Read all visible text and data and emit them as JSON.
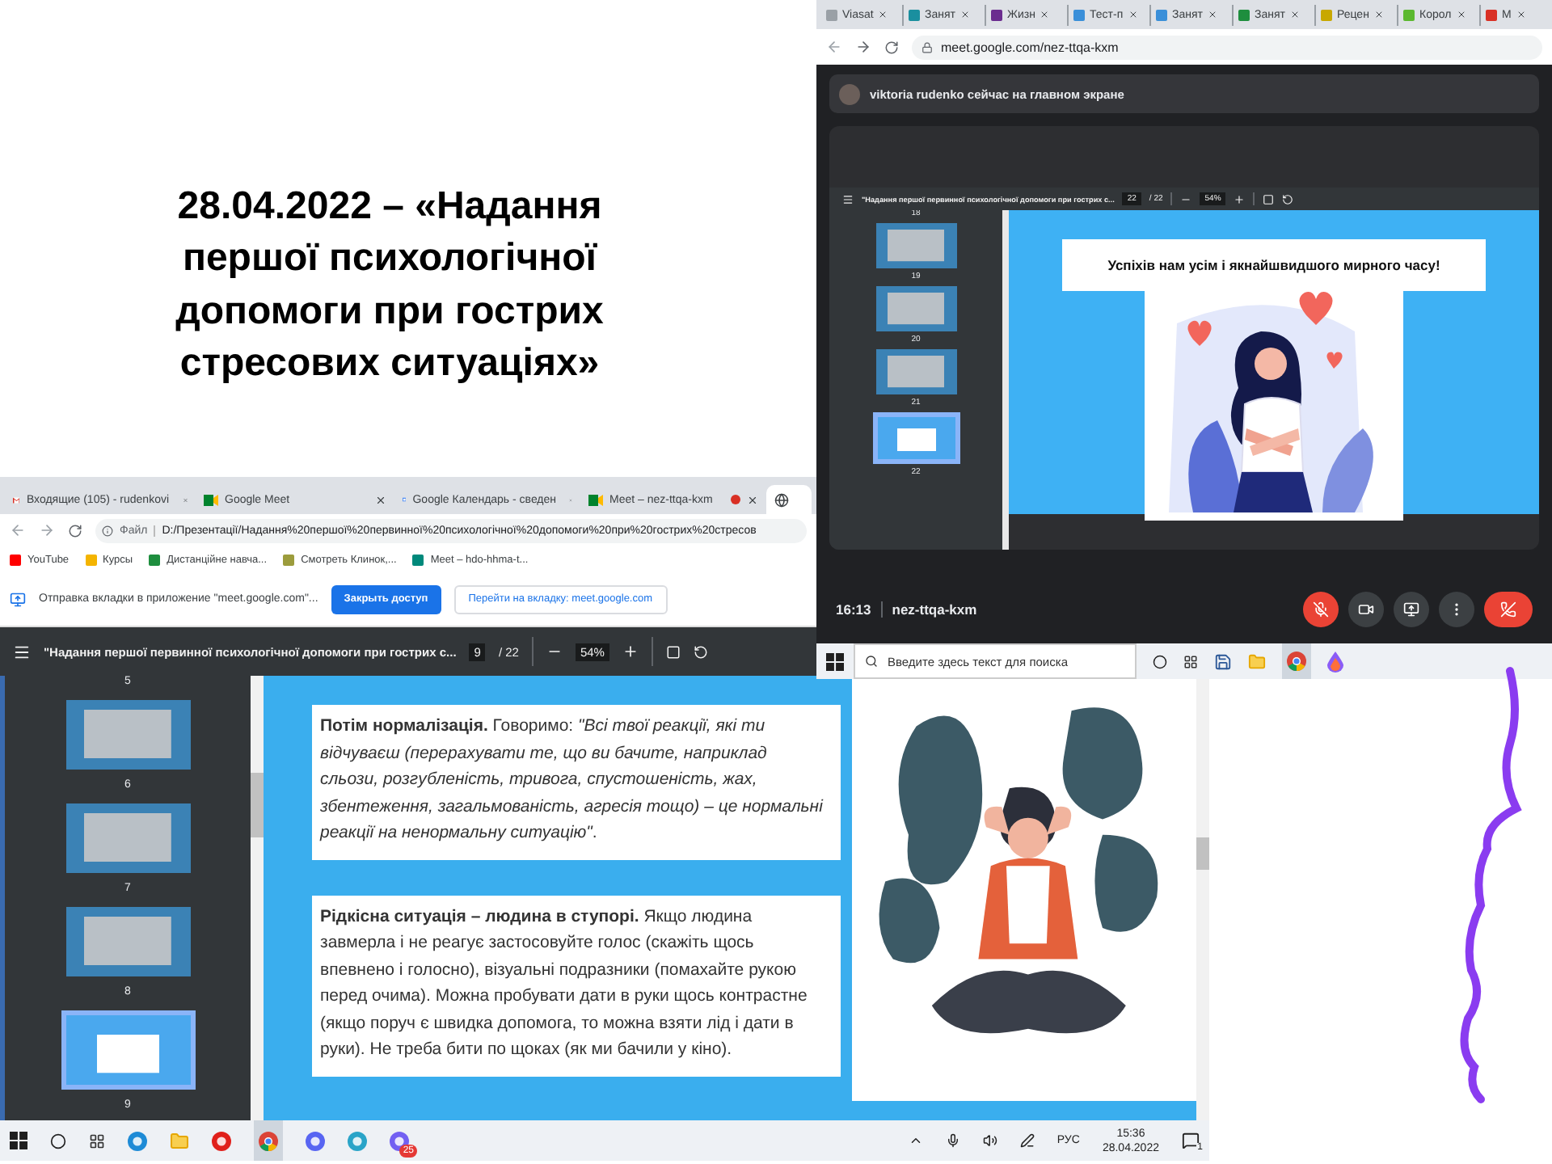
{
  "slide_title": "28.04.2022 – «Надання першої психологічної допомоги при гострих стресових ситуаціях»",
  "meet_window": {
    "tabs": [
      {
        "label": "Viasat",
        "color": "#9aa0a6",
        "selected": false
      },
      {
        "label": "Занят",
        "color": "#1a8f9f",
        "selected": false
      },
      {
        "label": "Жизн",
        "color": "#6b2c8f",
        "selected": false
      },
      {
        "label": "Тест-п",
        "color": "#3a8fd9",
        "selected": false
      },
      {
        "label": "Занят",
        "color": "#3a8fd9",
        "selected": false
      },
      {
        "label": "Занят",
        "color": "#1e8e3e",
        "selected": false
      },
      {
        "label": "Рецен",
        "color": "#c8a800",
        "selected": false
      },
      {
        "label": "Корол",
        "color": "#5bb82f",
        "selected": false
      },
      {
        "label": "M",
        "color": "#d93025",
        "selected": false
      }
    ],
    "url": "meet.google.com/nez-ttqa-kxm",
    "banner": "viktoria rudenko сейчас на главном экране",
    "pdf": {
      "title": "\"Надання першої первинної психологічної допомоги при гострих с...",
      "page": "22",
      "pages": "/ 22",
      "zoom": "54%",
      "top_number": "18",
      "thumbnails": [
        {
          "number": "19",
          "selected": false
        },
        {
          "number": "20",
          "selected": false
        },
        {
          "number": "21",
          "selected": false
        },
        {
          "number": "22",
          "selected": true
        }
      ],
      "slide_caption": "Успіхів нам усім і якнайшвидшого мирного часу!"
    },
    "call_time": "16:13",
    "meeting_code": "nez-ttqa-kxm",
    "mic_muted": true,
    "taskbar": {
      "search_placeholder": "Введите здесь текст для поиска"
    }
  },
  "browser_window": {
    "tabs": [
      {
        "label": "Входящие (105) - rudenkovi",
        "kind": "gmail",
        "recording": false,
        "selected": false
      },
      {
        "label": "Google Meet",
        "kind": "meet",
        "recording": false,
        "selected": false
      },
      {
        "label": "Google Календарь - сведен",
        "kind": "calendar",
        "recording": false,
        "selected": false
      },
      {
        "label": "Meet – nez-ttqa-kxm",
        "kind": "meet",
        "recording": true,
        "selected": false
      },
      {
        "kind": "globe",
        "recording": false,
        "selected": true
      }
    ],
    "file_label": "Файл",
    "path": "D:/Презентації/Надання%20першої%20первинної%20психологічної%20допомоги%20при%20гострих%20стресов",
    "bookmarks": [
      {
        "label": "YouTube",
        "color": "#ff0000"
      },
      {
        "label": "Курсы",
        "color": "#f4b400"
      },
      {
        "label": "Дистанційне навча...",
        "color": "#1e8e3e"
      },
      {
        "label": "Смотреть Клинок,...",
        "color": "#9c9c3c"
      },
      {
        "label": "Meet – hdo-hhma-t...",
        "color": "#00897b"
      }
    ],
    "infobar": {
      "text": "Отправка вкладки в приложение \"meet.google.com\"...",
      "primary": "Закрыть доступ",
      "secondary": "Перейти на вкладку: meet.google.com"
    },
    "pdf": {
      "title": "\"Надання першої первинної психологічної допомоги при гострих с...",
      "page": "9",
      "pages": "/ 22",
      "zoom": "54%",
      "top_number": "5",
      "thumbnails": [
        {
          "number": "6",
          "selected": false
        },
        {
          "number": "7",
          "selected": false
        },
        {
          "number": "8",
          "selected": false
        },
        {
          "number": "9",
          "selected": true
        }
      ],
      "paragraphs": [
        "**Потім нормалізація.** Говоримо: *\"Всі твої реакції, які ти відчуваєш (перерахувати те, що ви бачите, наприклад сльози, розгубленість, тривога, спустошеність, жах, збентеження, загальмованість, агресія тощо) – це нормальні реакції на ненормальну ситуацію\"*.",
        "**Рідкісна ситуація – людина в ступорі.**  Якщо людина завмерла і не реагує застосовуйте голос (скажіть щось впевнено і голосно), візуальні подразники (помахайте рукою перед очима). Можна пробувати дати в руки щось контрастне (якщо поруч є швидка допомога, то можна взяти лід і дати в руки). Не треба бити по щоках (як ми бачили у кіно)."
      ]
    },
    "taskbar": {
      "badge": "25",
      "language": "РУС",
      "time": "15:36",
      "date": "28.04.2022",
      "notifications": "1"
    }
  }
}
